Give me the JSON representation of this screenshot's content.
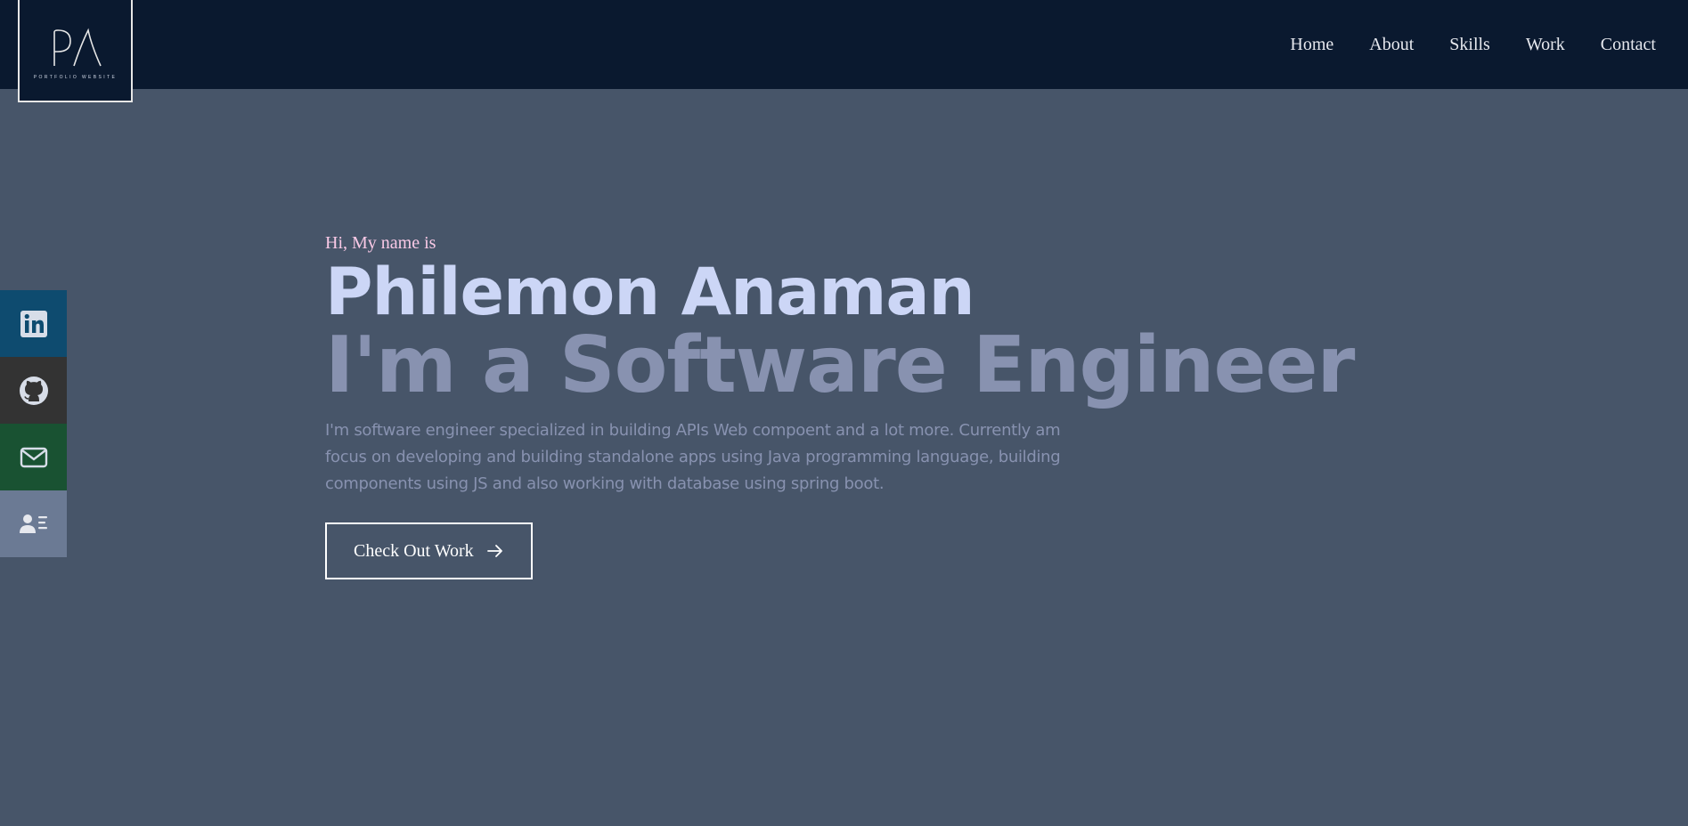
{
  "logo": {
    "mark": "PA",
    "subtitle": "PORTFOLIO WEBSITE"
  },
  "nav": {
    "items": [
      {
        "label": "Home"
      },
      {
        "label": "About"
      },
      {
        "label": "Skills"
      },
      {
        "label": "Work"
      },
      {
        "label": "Contact"
      }
    ]
  },
  "social": {
    "items": [
      {
        "icon": "linkedin-icon",
        "color": "#0e4b6f"
      },
      {
        "icon": "github-icon",
        "color": "#333333"
      },
      {
        "icon": "mail-icon",
        "color": "#195232"
      },
      {
        "icon": "resume-icon",
        "color": "#6b7a94"
      }
    ]
  },
  "hero": {
    "greeting": "Hi, My name is",
    "name": "Philemon Anaman",
    "role": "I'm a Software Engineer",
    "description": "I'm software engineer specialized in building APIs Web compoent and a lot more. Currently am focus on developing and building standalone apps using Java programming language, building components using JS and also working with database using spring boot.",
    "cta_label": "Check Out Work",
    "cta_icon": "arrow-right-icon"
  },
  "colors": {
    "navbar": "#0a192f",
    "background": "#475569",
    "name": "#ccd6f6",
    "role": "#8892b0",
    "greeting": "#f9c9e6"
  }
}
